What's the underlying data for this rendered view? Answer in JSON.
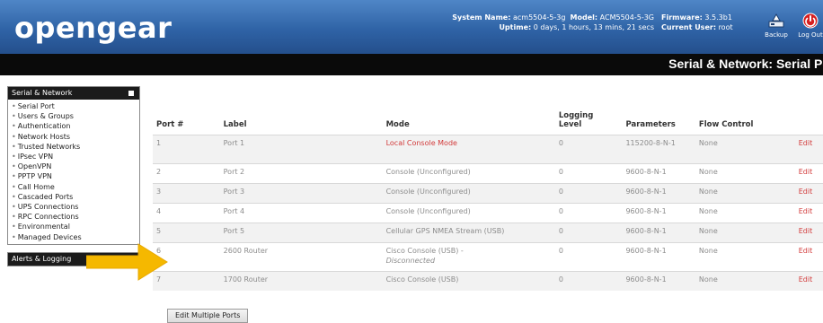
{
  "header": {
    "logo": "opengear",
    "system_name_label": "System Name:",
    "system_name_value": "acm5504-5-3g",
    "model_label": "Model:",
    "model_value": "ACM5504-5-3G",
    "firmware_label": "Firmware:",
    "firmware_value": "3.5.3b1",
    "uptime_label": "Uptime:",
    "uptime_value": "0 days, 1 hours, 13 mins, 21 secs",
    "current_user_label": "Current User:",
    "current_user_value": "root",
    "backup_label": "Backup",
    "logout_label": "Log Out"
  },
  "titlebar": {
    "title": "Serial & Network: Serial Port"
  },
  "sidebar": {
    "section_title": "Serial & Network",
    "items": [
      "Serial Port",
      "Users & Groups",
      "Authentication",
      "Network Hosts",
      "Trusted Networks",
      "IPsec VPN",
      "OpenVPN",
      "PPTP VPN",
      "Call Home",
      "Cascaded Ports",
      "UPS Connections",
      "RPC Connections",
      "Environmental",
      "Managed Devices"
    ],
    "section2_title": "Alerts & Logging"
  },
  "table": {
    "headers": {
      "port": "Port #",
      "label": "Label",
      "mode": "Mode",
      "logging": "Logging Level",
      "parameters": "Parameters",
      "flow": "Flow Control"
    },
    "rows": [
      {
        "port": "1",
        "label": "Port 1",
        "mode": "Local Console Mode",
        "logging": "0",
        "parameters": "115200-8-N-1",
        "flow": "None",
        "edit": "Edit"
      },
      {
        "port": "2",
        "label": "Port 2",
        "mode": "Console (Unconfigured)",
        "logging": "0",
        "parameters": "9600-8-N-1",
        "flow": "None",
        "edit": "Edit"
      },
      {
        "port": "3",
        "label": "Port 3",
        "mode": "Console (Unconfigured)",
        "logging": "0",
        "parameters": "9600-8-N-1",
        "flow": "None",
        "edit": "Edit"
      },
      {
        "port": "4",
        "label": "Port 4",
        "mode": "Console (Unconfigured)",
        "logging": "0",
        "parameters": "9600-8-N-1",
        "flow": "None",
        "edit": "Edit"
      },
      {
        "port": "5",
        "label": "Port 5",
        "mode": "Cellular GPS NMEA Stream (USB)",
        "logging": "0",
        "parameters": "9600-8-N-1",
        "flow": "None",
        "edit": "Edit"
      },
      {
        "port": "6",
        "label": "2600 Router",
        "mode": "Cisco Console (USB) -",
        "mode_sub": "Disconnected",
        "logging": "0",
        "parameters": "9600-8-N-1",
        "flow": "None",
        "edit": "Edit"
      },
      {
        "port": "7",
        "label": "1700 Router",
        "mode": "Cisco Console (USB)",
        "logging": "0",
        "parameters": "9600-8-N-1",
        "flow": "None",
        "edit": "Edit"
      }
    ]
  },
  "edit_multiple_label": "Edit Multiple Ports",
  "colors": {
    "header_blue": "#2f63a6",
    "titlebar_black": "#0a0a0a",
    "edit_red": "#d23a3a",
    "arrow_yellow": "#f5b800"
  }
}
